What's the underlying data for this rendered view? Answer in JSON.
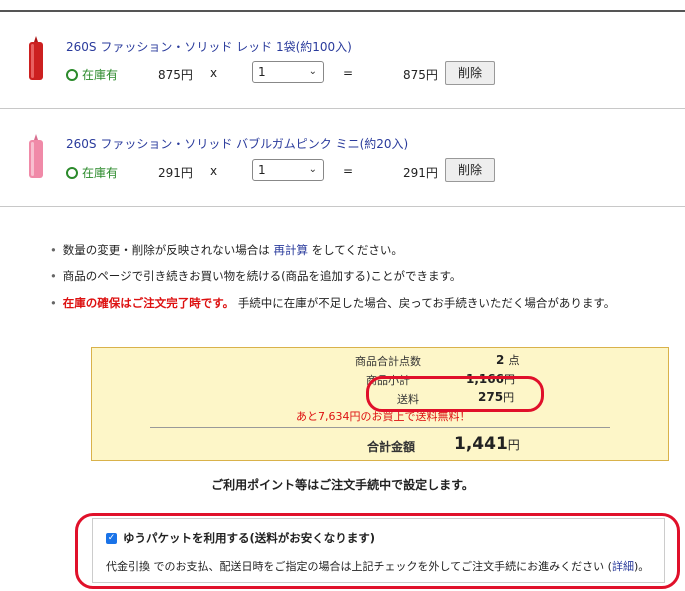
{
  "items": [
    {
      "name": "260S ファッション・ソリッド レッド 1袋(約100入)",
      "color": "#cc2020",
      "stock": "在庫有",
      "price": "875円",
      "mult": "x",
      "qty": "1",
      "eq": "=",
      "subtotal": "875円",
      "delete_label": "削除"
    },
    {
      "name": "260S ファッション・ソリッド バブルガムピンク ミニ(約20入)",
      "color": "#f08aa8",
      "stock": "在庫有",
      "price": "291円",
      "mult": "x",
      "qty": "1",
      "eq": "=",
      "subtotal": "291円",
      "delete_label": "削除"
    }
  ],
  "notes": {
    "line1_pre": "数量の変更・削除が反映されない場合は",
    "line1_link": "再計算",
    "line1_post": "をしてください。",
    "line2": "商品のページで引き続きお買い物を続ける(商品を追加する)ことができます。",
    "line3_red": "在庫の確保はご注文完了時です。",
    "line3_rest": "手続中に在庫が不足した場合、戻ってお手続きいただく場合があります。"
  },
  "summary": {
    "count_label": "商品合計点数",
    "count_value": "2",
    "count_unit": "点",
    "subtotal_label": "商品小計",
    "subtotal_value": "1,166",
    "subtotal_unit": "円",
    "shipping_label": "送料",
    "shipping_value": "275",
    "shipping_unit": "円",
    "free_note": "あと7,634円のお買上で送料無料！",
    "total_label": "合計金額",
    "total_value": "1,441",
    "total_unit": "円"
  },
  "points_note": "ご利用ポイント等はご注文手続中で設定します。",
  "yuupacket": {
    "checkbox_label": "ゆうパケットを利用する(送料がお安くなります)",
    "checked": true,
    "note_pre": "代金引換",
    "note_mid": "でのお支払、配送日時をご指定の場合は上記チェックを外してご注文手続にお進みください",
    "note_link": "詳細",
    "note_open": "(",
    "note_close": ")。"
  },
  "colors": {
    "accent_link": "#2a3b9c",
    "stock_green": "#2b8a2b",
    "warning_red": "#d11111",
    "highlight_red": "#e0102a",
    "summary_bg": "#fdf6c8"
  }
}
